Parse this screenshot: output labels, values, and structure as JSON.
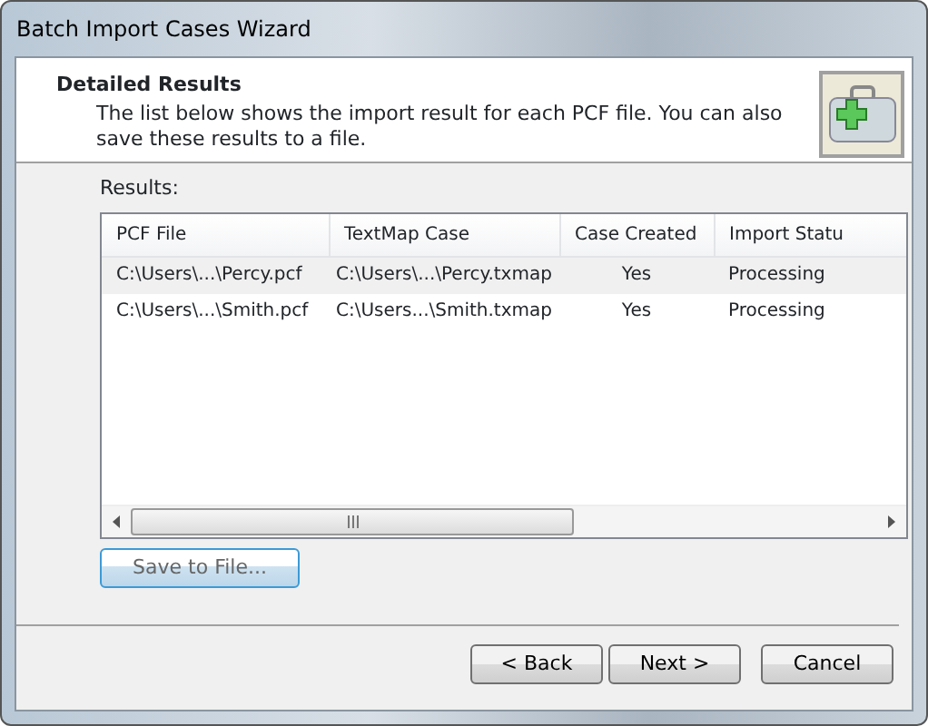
{
  "window": {
    "title": "Batch Import Cases Wizard"
  },
  "header": {
    "title": "Detailed Results",
    "description": "The list below shows the import result for each PCF file.  You can also save these results to a file."
  },
  "results": {
    "label": "Results:",
    "columns": [
      "PCF File",
      "TextMap Case",
      "Case Created",
      "Import Statu"
    ],
    "rows": [
      {
        "cells": [
          "C:\\Users\\...\\Percy.pcf",
          "C:\\Users\\...\\Percy.txmap",
          "Yes",
          "Processing"
        ],
        "selected": true
      },
      {
        "cells": [
          "C:\\Users\\...\\Smith.pcf",
          "C:\\Users...\\Smith.txmap",
          "Yes",
          "Processing"
        ],
        "selected": false
      }
    ]
  },
  "save_button": {
    "label": "Save to File...",
    "focused": true
  },
  "buttons": [
    {
      "label": "< Back"
    },
    {
      "label": "Next >"
    },
    {
      "label": "Cancel"
    }
  ]
}
